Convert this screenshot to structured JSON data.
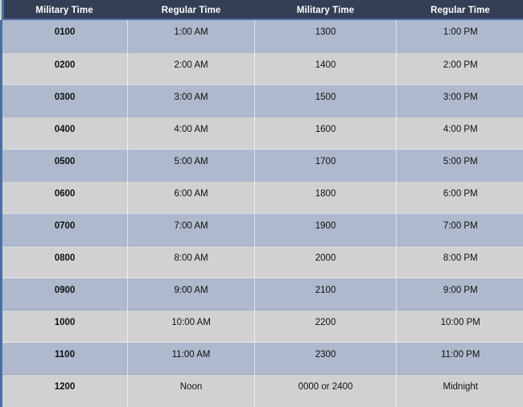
{
  "table": {
    "columns": [
      {
        "key": "mil_am",
        "label": "Military Time"
      },
      {
        "key": "reg_am",
        "label": "Regular Time"
      },
      {
        "key": "mil_pm",
        "label": "Military Time"
      },
      {
        "key": "reg_pm",
        "label": "Regular Time"
      }
    ],
    "rows": [
      {
        "mil_am": "0100",
        "reg_am": "1:00 AM",
        "mil_pm": "1300",
        "reg_pm": "1:00 PM"
      },
      {
        "mil_am": "0200",
        "reg_am": "2:00 AM",
        "mil_pm": "1400",
        "reg_pm": "2:00 PM"
      },
      {
        "mil_am": "0300",
        "reg_am": "3:00 AM",
        "mil_pm": "1500",
        "reg_pm": "3:00 PM"
      },
      {
        "mil_am": "0400",
        "reg_am": "4:00 AM",
        "mil_pm": "1600",
        "reg_pm": "4:00 PM"
      },
      {
        "mil_am": "0500",
        "reg_am": "5:00 AM",
        "mil_pm": "1700",
        "reg_pm": "5:00 PM"
      },
      {
        "mil_am": "0600",
        "reg_am": "6:00 AM",
        "mil_pm": "1800",
        "reg_pm": "6:00 PM"
      },
      {
        "mil_am": "0700",
        "reg_am": "7:00 AM",
        "mil_pm": "1900",
        "reg_pm": "7:00 PM"
      },
      {
        "mil_am": "0800",
        "reg_am": "8:00 AM",
        "mil_pm": "2000",
        "reg_pm": "8:00 PM"
      },
      {
        "mil_am": "0900",
        "reg_am": "9:00 AM",
        "mil_pm": "2100",
        "reg_pm": "9:00 PM"
      },
      {
        "mil_am": "1000",
        "reg_am": "10:00 AM",
        "mil_pm": "2200",
        "reg_pm": "10:00 PM"
      },
      {
        "mil_am": "1100",
        "reg_am": "11:00 AM",
        "mil_pm": "2300",
        "reg_pm": "11:00 PM"
      },
      {
        "mil_am": "1200",
        "reg_am": "Noon",
        "mil_pm": "0000 or 2400",
        "reg_pm": "Midnight"
      }
    ]
  },
  "colors": {
    "header_background": "#333f54",
    "header_text": "#ffffff",
    "row_odd_background": "#aeb9cd",
    "row_even_background": "#d1d1d1",
    "accent_border": "#4a6fa5",
    "body_text": "#111111"
  }
}
